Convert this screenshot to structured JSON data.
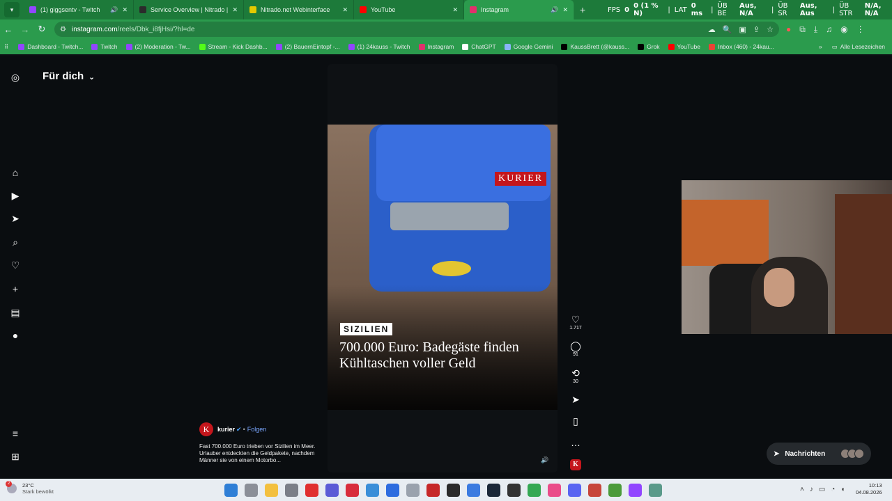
{
  "browser": {
    "tabs": [
      {
        "title": "(1) giggsentv - Twitch",
        "color": "#9146ff",
        "sound": true
      },
      {
        "title": "Service Overview | Nitrado | Ni",
        "color": "#2b2b2b",
        "sound": false
      },
      {
        "title": "Nitrado.net Webinterface",
        "color": "#e4c900",
        "sound": false
      },
      {
        "title": "YouTube",
        "color": "#ff0000",
        "sound": false
      },
      {
        "title": "Instagram",
        "color": "#e1306c",
        "sound": true,
        "active": true
      }
    ],
    "url_host": "instagram.com",
    "url_path": "/reels/Dbk_i8fjHsi/?hl=de",
    "bookmarks": [
      {
        "label": "Dashboard - Twitch...",
        "color": "#9146ff"
      },
      {
        "label": "Twitch",
        "color": "#9146ff"
      },
      {
        "label": "(2) Moderation - Tw...",
        "color": "#9146ff"
      },
      {
        "label": "Stream - Kick Dashb...",
        "color": "#53fc18"
      },
      {
        "label": "(2) BauernEintopf -...",
        "color": "#9146ff"
      },
      {
        "label": "(1) 24kauss - Twitch",
        "color": "#9146ff"
      },
      {
        "label": "Instagram",
        "color": "#e1306c"
      },
      {
        "label": "ChatGPT",
        "color": "#ffffff"
      },
      {
        "label": "Google Gemini",
        "color": "#8ab4f8"
      },
      {
        "label": "KaussBrett (@kauss...",
        "color": "#000000"
      },
      {
        "label": "Grok",
        "color": "#000000"
      },
      {
        "label": "YouTube",
        "color": "#ff0000"
      },
      {
        "label": "Inbox (460) - 24kau...",
        "color": "#ea4335"
      }
    ],
    "all_bookmarks": "Alle Lesezeichen"
  },
  "overlay": {
    "fps_label": "FPS",
    "fps_value": "0",
    "fps_pct": "0 (1 % N)",
    "lat_label": "LAT",
    "lat_value": "0 ms",
    "be_label": "ÜB BE",
    "be_value": "Aus, N/A",
    "sr_label": "ÜB SR",
    "sr_value": "Aus, Aus",
    "str_label": "ÜB STR",
    "str_value": "N/A, N/A"
  },
  "instagram": {
    "feed_title": "Für dich",
    "reel": {
      "brand_badge": "KURIER",
      "section": "SIZILIEN",
      "headline": "700.000 Euro: Badegäste finden Kühltaschen voller Geld"
    },
    "actions": {
      "likes": "1.717",
      "comments": "91",
      "reposts": "30"
    },
    "author": {
      "avatar_letter": "K",
      "name": "kurier",
      "follow": "Folgen"
    },
    "caption": "Fast 700.000 Euro trieben vor Sizilien im Meer. Urlauber entdeckten die Geldpakete, nachdem Männer sie von einem Motorbo...",
    "messages_label": "Nachrichten"
  },
  "taskbar": {
    "weather_temp": "23°C",
    "weather_desc": "Stark bewölkt",
    "notification_count": "2",
    "time": "10:13",
    "date": "04.08.2026"
  }
}
